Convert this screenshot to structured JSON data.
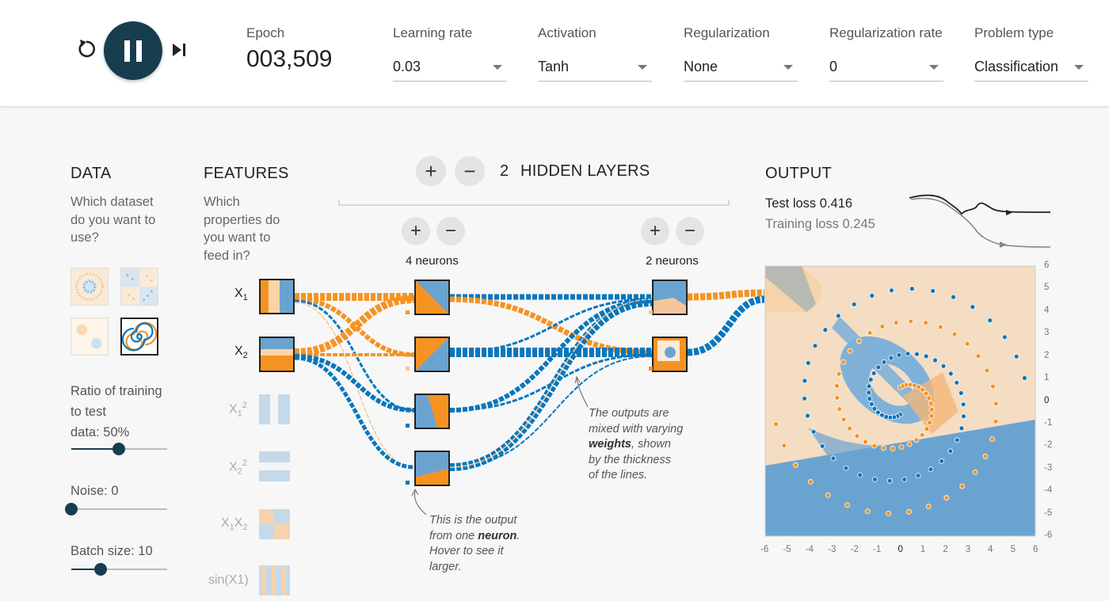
{
  "controls": {
    "reset_icon": "reset-icon",
    "play_icon": "pause-icon",
    "step_icon": "step-icon",
    "epoch_label": "Epoch",
    "epoch_value": "003,509"
  },
  "params": [
    {
      "label": "Learning rate",
      "value": "0.03"
    },
    {
      "label": "Activation",
      "value": "Tanh"
    },
    {
      "label": "Regularization",
      "value": "None"
    },
    {
      "label": "Regularization rate",
      "value": "0"
    },
    {
      "label": "Problem type",
      "value": "Classification"
    }
  ],
  "data_panel": {
    "title": "DATA",
    "question": [
      "Which dataset",
      "do you want to",
      "use?"
    ],
    "ratio_label": [
      "Ratio of training",
      "to test",
      "data:  50%"
    ],
    "ratio_value": 0.5,
    "noise_label": "Noise:  0",
    "noise_value": 0,
    "batch_label": "Batch size:  10",
    "batch_value": 0.3
  },
  "features_panel": {
    "title": "FEATURES",
    "question": [
      "Which",
      "properties do",
      "you want to",
      "feed in?"
    ],
    "features": [
      "X1",
      "X2",
      "X1^2",
      "X2^2",
      "X1X2",
      "sin(X1)"
    ]
  },
  "network": {
    "hidden_layers_count": "2",
    "hidden_layers_label": "HIDDEN LAYERS",
    "layer1_neurons": "4 neurons",
    "layer2_neurons": "2 neurons",
    "plus": "+",
    "minus": "−"
  },
  "notes": {
    "weights": [
      "The outputs are",
      "mixed with varying",
      "weights",
      ", shown",
      "by the thickness",
      "of the lines."
    ],
    "neuron": [
      "This is the output",
      "from one ",
      "neuron",
      ".",
      "Hover to see it",
      "larger."
    ]
  },
  "output_panel": {
    "title": "OUTPUT",
    "test_loss": "Test loss 0.416",
    "training_loss": "Training loss 0.245",
    "x_ticks": [
      "-6",
      "-5",
      "-4",
      "-3",
      "-2",
      "-1",
      "0",
      "1",
      "2",
      "3",
      "4",
      "5",
      "6"
    ],
    "y_ticks": [
      "6",
      "5",
      "4",
      "3",
      "2",
      "1",
      "0",
      "-1",
      "-2",
      "-3",
      "-4",
      "-5",
      "-6"
    ]
  },
  "colors": {
    "orange": "#f59322",
    "blue": "#0877bd",
    "dark": "#183d4e"
  }
}
